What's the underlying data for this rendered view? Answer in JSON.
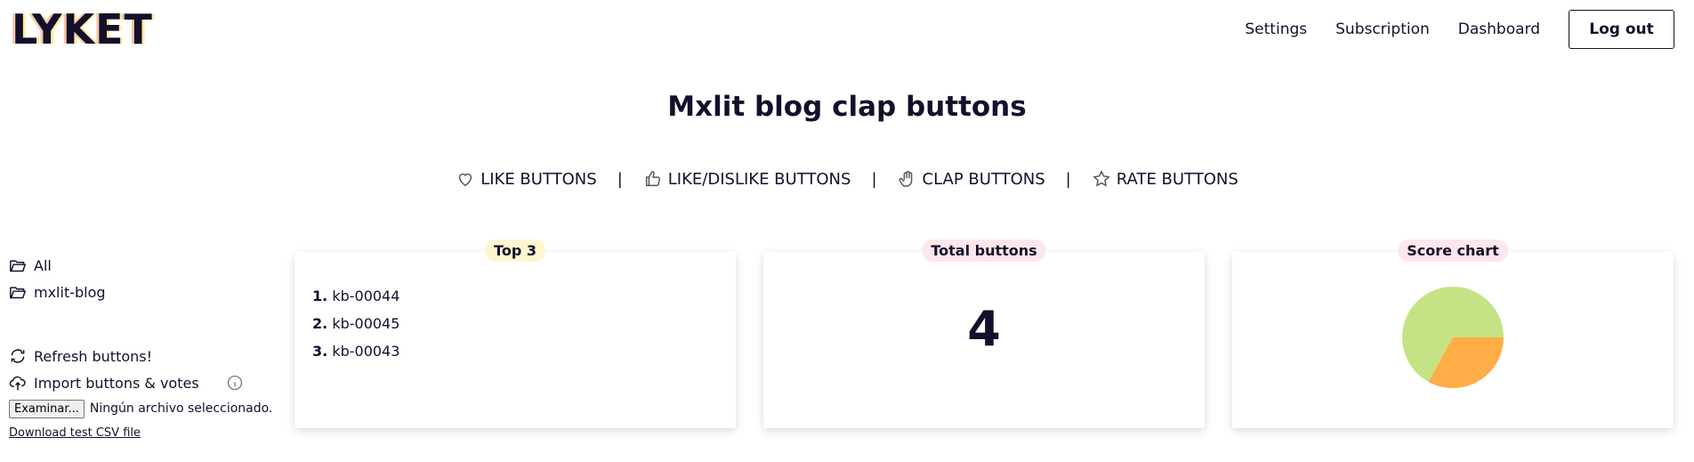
{
  "header": {
    "logo": "LYKET",
    "nav": {
      "settings": "Settings",
      "subscription": "Subscription",
      "dashboard": "Dashboard",
      "logout": "Log out"
    }
  },
  "page_title": "Mxlit blog clap buttons",
  "tabs": {
    "like": "LIKE BUTTONS",
    "like_dislike": "LIKE/DISLIKE BUTTONS",
    "clap": "CLAP BUTTONS",
    "rate": "RATE BUTTONS",
    "separator": "|"
  },
  "sidebar": {
    "folders": [
      "All",
      "mxlit-blog"
    ],
    "refresh": "Refresh buttons!",
    "import": "Import buttons & votes",
    "file_button": "Examinar...",
    "file_status": "Ningún archivo seleccionado.",
    "csv_link": "Download test CSV file"
  },
  "cards": {
    "top3": {
      "label": "Top 3",
      "items": [
        {
          "rank": "1.",
          "name": "kb-00044"
        },
        {
          "rank": "2.",
          "name": "kb-00045"
        },
        {
          "rank": "3.",
          "name": "kb-00043"
        }
      ]
    },
    "total": {
      "label": "Total buttons",
      "value": "4"
    },
    "score": {
      "label": "Score chart"
    }
  },
  "colors": {
    "top3_label_bg": "#fff6d0",
    "total_label_bg": "#fde7ec",
    "score_label_bg": "#fde7ec",
    "pie_green": "#c5e384",
    "pie_orange": "#ffad47"
  },
  "chart_data": {
    "type": "pie",
    "values": [
      67,
      33
    ],
    "colors": [
      "#c5e384",
      "#ffad47"
    ]
  }
}
